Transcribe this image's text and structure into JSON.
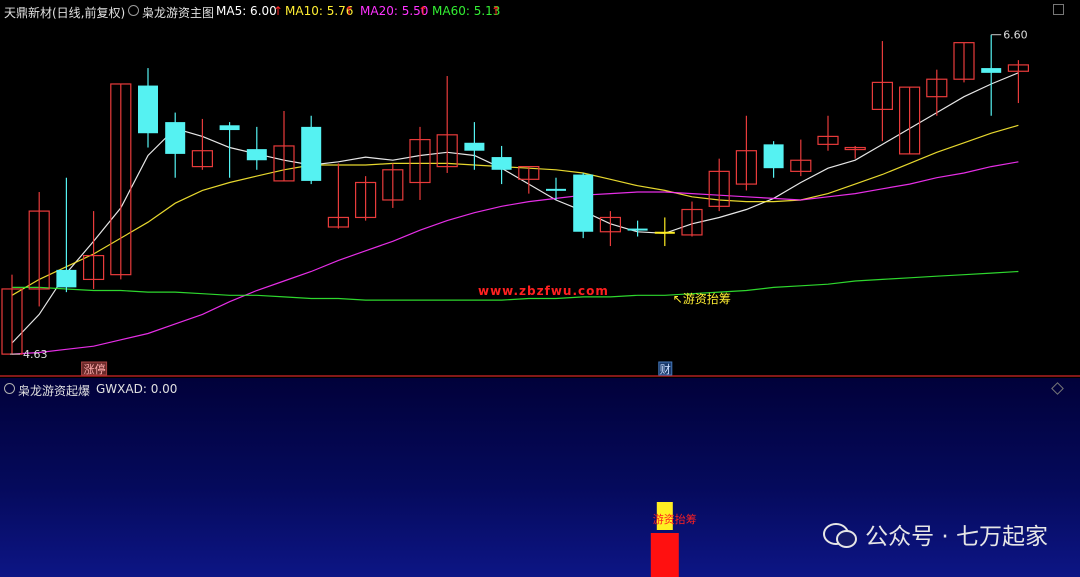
{
  "header": {
    "stock": "天鼎新材(日线,前复权)",
    "indicator": "枭龙游资主图",
    "ma": [
      {
        "label": "MA5: 6.00",
        "color": "#ffffff"
      },
      {
        "label": "MA10: 5.76",
        "color": "#ffee33"
      },
      {
        "label": "MA20: 5.50",
        "color": "#ff33ff"
      },
      {
        "label": "MA60: 5.13",
        "color": "#33ee33"
      }
    ],
    "arrow": "↑",
    "arrow_color": "#ff2222"
  },
  "sub_header": {
    "indicator": "枭龙游资起爆",
    "value": "GWXAD: 0.00"
  },
  "annotations": {
    "high": "6.60",
    "low": "4.63",
    "zhangting": "涨停",
    "cai": "财",
    "youzi": "↖游资抬筹",
    "url": "www.zbzfwu.com",
    "sub_label": "游资抬筹"
  },
  "watermark": "公众号 · 七万起家",
  "colors": {
    "up": "#e83b3b",
    "down": "#55f2f2",
    "signal": "#ffee22",
    "red_bar": "#ff1010"
  },
  "chart_data": {
    "type": "candlestick",
    "candles": [
      {
        "o": 4.63,
        "c": 5.04,
        "h": 5.13,
        "l": 4.63
      },
      {
        "o": 5.04,
        "c": 5.53,
        "h": 5.65,
        "l": 4.93
      },
      {
        "o": 5.16,
        "c": 5.05,
        "h": 5.74,
        "l": 5.02
      },
      {
        "o": 5.1,
        "c": 5.25,
        "h": 5.53,
        "l": 5.04
      },
      {
        "o": 5.13,
        "c": 6.33,
        "h": 6.33,
        "l": 5.1
      },
      {
        "o": 6.32,
        "c": 6.02,
        "h": 6.43,
        "l": 5.93
      },
      {
        "o": 6.09,
        "c": 5.89,
        "h": 6.15,
        "l": 5.74
      },
      {
        "o": 5.81,
        "c": 5.91,
        "h": 6.11,
        "l": 5.79
      },
      {
        "o": 6.07,
        "c": 6.04,
        "h": 6.09,
        "l": 5.74
      },
      {
        "o": 5.92,
        "c": 5.85,
        "h": 6.06,
        "l": 5.79
      },
      {
        "o": 5.72,
        "c": 5.94,
        "h": 6.16,
        "l": 5.72
      },
      {
        "o": 6.06,
        "c": 5.72,
        "h": 6.13,
        "l": 5.7
      },
      {
        "o": 5.43,
        "c": 5.49,
        "h": 5.83,
        "l": 5.42
      },
      {
        "o": 5.49,
        "c": 5.71,
        "h": 5.75,
        "l": 5.47
      },
      {
        "o": 5.6,
        "c": 5.79,
        "h": 5.83,
        "l": 5.55
      },
      {
        "o": 5.71,
        "c": 5.98,
        "h": 6.06,
        "l": 5.6
      },
      {
        "o": 5.81,
        "c": 6.01,
        "h": 6.38,
        "l": 5.77
      },
      {
        "o": 5.96,
        "c": 5.91,
        "h": 6.09,
        "l": 5.79
      },
      {
        "o": 5.87,
        "c": 5.79,
        "h": 5.94,
        "l": 5.7
      },
      {
        "o": 5.73,
        "c": 5.81,
        "h": 5.81,
        "l": 5.64
      },
      {
        "o": 5.67,
        "c": 5.66,
        "h": 5.74,
        "l": 5.6
      },
      {
        "o": 5.76,
        "c": 5.4,
        "h": 5.77,
        "l": 5.36
      },
      {
        "o": 5.4,
        "c": 5.49,
        "h": 5.53,
        "l": 5.31
      },
      {
        "o": 5.42,
        "c": 5.41,
        "h": 5.47,
        "l": 5.37
      },
      {
        "o": 5.4,
        "c": 5.4,
        "h": 5.49,
        "l": 5.31
      },
      {
        "o": 5.38,
        "c": 5.54,
        "h": 5.59,
        "l": 5.37
      },
      {
        "o": 5.56,
        "c": 5.78,
        "h": 5.86,
        "l": 5.53
      },
      {
        "o": 5.7,
        "c": 5.91,
        "h": 6.13,
        "l": 5.66
      },
      {
        "o": 5.95,
        "c": 5.8,
        "h": 5.97,
        "l": 5.74
      },
      {
        "o": 5.78,
        "c": 5.85,
        "h": 5.98,
        "l": 5.75
      },
      {
        "o": 5.95,
        "c": 6.0,
        "h": 6.13,
        "l": 5.91
      },
      {
        "o": 5.92,
        "c": 5.93,
        "h": 5.94,
        "l": 5.86
      },
      {
        "o": 6.17,
        "c": 6.34,
        "h": 6.6,
        "l": 5.97
      },
      {
        "o": 5.89,
        "c": 6.31,
        "h": 6.31,
        "l": 5.89
      },
      {
        "o": 6.25,
        "c": 6.36,
        "h": 6.42,
        "l": 6.13
      },
      {
        "o": 6.36,
        "c": 6.59,
        "h": 6.59,
        "l": 6.34
      },
      {
        "o": 6.43,
        "c": 6.4,
        "h": 6.64,
        "l": 6.13
      },
      {
        "o": 6.41,
        "c": 6.45,
        "h": 6.48,
        "l": 6.21
      }
    ],
    "highlight_index": 24,
    "signal_index": 24,
    "sub_values": [
      0,
      0,
      0,
      0,
      0,
      0,
      0,
      0,
      0,
      0,
      0,
      0,
      0,
      0,
      0,
      0,
      0,
      0,
      0,
      0,
      0,
      0,
      0,
      0,
      0.65,
      0,
      0,
      0,
      0,
      0,
      0,
      0,
      0,
      0,
      0,
      0,
      0,
      0
    ],
    "ma": {
      "MA5": [
        4.7,
        4.88,
        5.14,
        5.34,
        5.55,
        5.88,
        6.05,
        6.0,
        5.93,
        5.89,
        5.85,
        5.82,
        5.84,
        5.87,
        5.85,
        5.88,
        5.9,
        5.88,
        5.8,
        5.7,
        5.6,
        5.53,
        5.45,
        5.4,
        5.39,
        5.45,
        5.49,
        5.54,
        5.61,
        5.71,
        5.8,
        5.85,
        5.95,
        6.05,
        6.15,
        6.25,
        6.33,
        6.4
      ],
      "MA10": [
        5.0,
        5.1,
        5.18,
        5.26,
        5.36,
        5.46,
        5.58,
        5.66,
        5.71,
        5.75,
        5.79,
        5.82,
        5.82,
        5.82,
        5.83,
        5.83,
        5.83,
        5.82,
        5.81,
        5.8,
        5.79,
        5.77,
        5.73,
        5.69,
        5.66,
        5.62,
        5.6,
        5.59,
        5.59,
        5.6,
        5.64,
        5.7,
        5.76,
        5.83,
        5.9,
        5.96,
        6.02,
        6.07
      ],
      "MA20": [
        4.63,
        4.64,
        4.66,
        4.68,
        4.72,
        4.76,
        4.82,
        4.88,
        4.96,
        5.03,
        5.09,
        5.15,
        5.22,
        5.28,
        5.34,
        5.41,
        5.47,
        5.52,
        5.56,
        5.59,
        5.61,
        5.63,
        5.64,
        5.65,
        5.65,
        5.64,
        5.63,
        5.62,
        5.61,
        5.6,
        5.62,
        5.64,
        5.67,
        5.7,
        5.74,
        5.77,
        5.81,
        5.84
      ],
      "MA60": [
        5.05,
        5.05,
        5.04,
        5.03,
        5.03,
        5.02,
        5.02,
        5.01,
        5.0,
        5.0,
        4.99,
        4.98,
        4.98,
        4.97,
        4.97,
        4.97,
        4.97,
        4.97,
        4.97,
        4.98,
        4.98,
        4.99,
        4.99,
        5.0,
        5.0,
        5.01,
        5.02,
        5.03,
        5.05,
        5.06,
        5.07,
        5.09,
        5.1,
        5.11,
        5.12,
        5.13,
        5.14,
        5.15
      ]
    },
    "ylim": [
      4.53,
      6.72
    ]
  }
}
